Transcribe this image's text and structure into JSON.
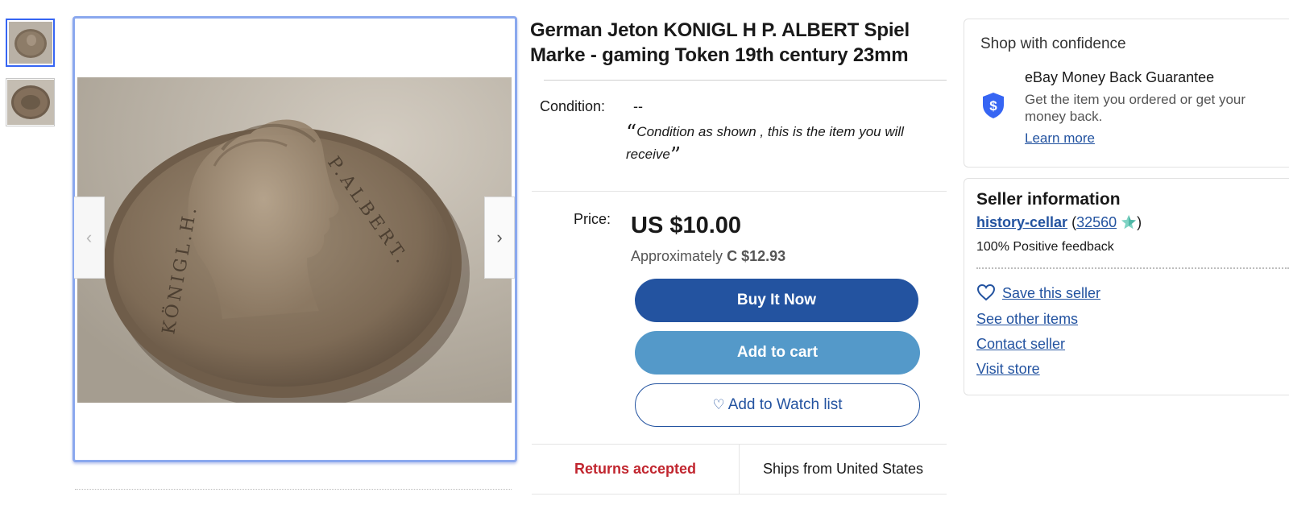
{
  "listing": {
    "title": "German Jeton KONIGL H P. ALBERT Spiel Marke - gaming Token 19th century 23mm",
    "condition_label": "Condition:",
    "condition_value": "--",
    "condition_desc": "Condition as shown , this is the item you will receive",
    "price_label": "Price:",
    "price": "US $10.00",
    "approx_prefix": "Approximately",
    "approx_value": "C $12.93",
    "buy_now": "Buy It Now",
    "add_to_cart": "Add to cart",
    "add_to_watch": "Add to Watch list",
    "returns": "Returns accepted",
    "ships_from": "Ships from United States"
  },
  "gallery": {
    "coin_text_left": "KÖNIGL.H.",
    "coin_text_right": "P.ALBERT."
  },
  "confidence": {
    "title": "Shop with confidence",
    "guarantee_title": "eBay Money Back Guarantee",
    "guarantee_desc": "Get the item you ordered or get your money back.",
    "learn_more": "Learn more",
    "shield_symbol": "$"
  },
  "seller": {
    "title": "Seller information",
    "name": "history-cellar",
    "feedback_count": "32560",
    "open_paren": "(",
    "close_paren": ")",
    "positive": "100% Positive feedback",
    "save_seller": "Save this seller",
    "other_items": "See other items",
    "contact": "Contact seller",
    "visit_store": "Visit store"
  },
  "colors": {
    "primary_blue": "#2353a0",
    "cart_blue": "#5499c9",
    "returns_red": "#c1262f",
    "gallery_border": "#8aa8ee"
  },
  "icons": [
    "chevron-left-icon",
    "chevron-right-icon",
    "heart-icon",
    "shield-dollar-icon",
    "star-icon"
  ]
}
